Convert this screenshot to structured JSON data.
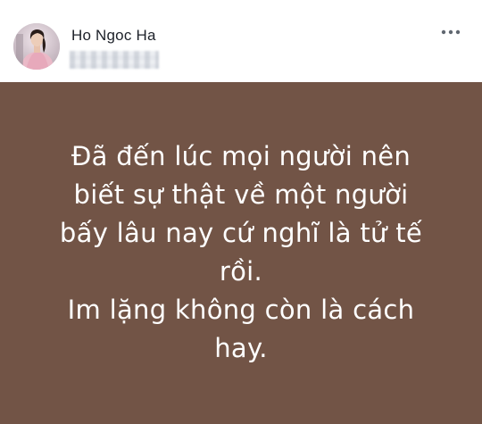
{
  "post": {
    "author": {
      "name": "Ho Ngoc Ha",
      "avatar": "profile-photo"
    },
    "more_icon": "more-horizontal-icon",
    "status_background": "#725446",
    "status_text_color": "#ffffff",
    "status_text": "Đã đến lúc mọi người nên\nbiết sự thật về một người\nbấy lâu nay cứ nghĩ là tử tế\nrồi.\nIm lặng không còn là cách\nhay."
  }
}
